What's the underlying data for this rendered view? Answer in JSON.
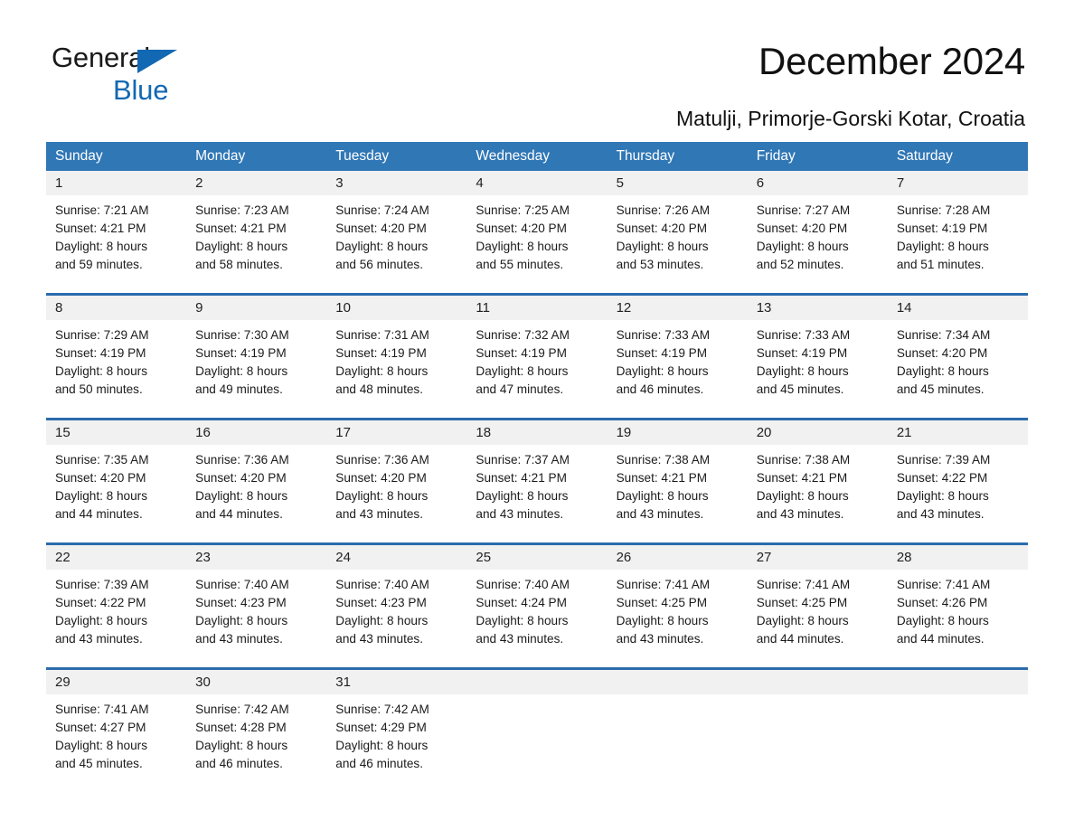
{
  "brand": {
    "name_part1": "General",
    "name_part2": "Blue",
    "triangle_color": "#1268b3",
    "text_color": "#1a1a1a"
  },
  "header": {
    "title": "December 2024",
    "subtitle": "Matulji, Primorje-Gorski Kotar, Croatia"
  },
  "theme": {
    "header_blue": "#3077b6",
    "separator_blue": "#2b6cad",
    "date_row_gray": "#f1f1f1",
    "body_white": "#ffffff",
    "text_dark": "#1b1b1b"
  },
  "weekdays": [
    "Sunday",
    "Monday",
    "Tuesday",
    "Wednesday",
    "Thursday",
    "Friday",
    "Saturday"
  ],
  "weeks": [
    {
      "dates": [
        "1",
        "2",
        "3",
        "4",
        "5",
        "6",
        "7"
      ],
      "cells": [
        {
          "sunrise": "Sunrise: 7:21 AM",
          "sunset": "Sunset: 4:21 PM",
          "daylight1": "Daylight: 8 hours",
          "daylight2": "and 59 minutes."
        },
        {
          "sunrise": "Sunrise: 7:23 AM",
          "sunset": "Sunset: 4:21 PM",
          "daylight1": "Daylight: 8 hours",
          "daylight2": "and 58 minutes."
        },
        {
          "sunrise": "Sunrise: 7:24 AM",
          "sunset": "Sunset: 4:20 PM",
          "daylight1": "Daylight: 8 hours",
          "daylight2": "and 56 minutes."
        },
        {
          "sunrise": "Sunrise: 7:25 AM",
          "sunset": "Sunset: 4:20 PM",
          "daylight1": "Daylight: 8 hours",
          "daylight2": "and 55 minutes."
        },
        {
          "sunrise": "Sunrise: 7:26 AM",
          "sunset": "Sunset: 4:20 PM",
          "daylight1": "Daylight: 8 hours",
          "daylight2": "and 53 minutes."
        },
        {
          "sunrise": "Sunrise: 7:27 AM",
          "sunset": "Sunset: 4:20 PM",
          "daylight1": "Daylight: 8 hours",
          "daylight2": "and 52 minutes."
        },
        {
          "sunrise": "Sunrise: 7:28 AM",
          "sunset": "Sunset: 4:19 PM",
          "daylight1": "Daylight: 8 hours",
          "daylight2": "and 51 minutes."
        }
      ]
    },
    {
      "dates": [
        "8",
        "9",
        "10",
        "11",
        "12",
        "13",
        "14"
      ],
      "cells": [
        {
          "sunrise": "Sunrise: 7:29 AM",
          "sunset": "Sunset: 4:19 PM",
          "daylight1": "Daylight: 8 hours",
          "daylight2": "and 50 minutes."
        },
        {
          "sunrise": "Sunrise: 7:30 AM",
          "sunset": "Sunset: 4:19 PM",
          "daylight1": "Daylight: 8 hours",
          "daylight2": "and 49 minutes."
        },
        {
          "sunrise": "Sunrise: 7:31 AM",
          "sunset": "Sunset: 4:19 PM",
          "daylight1": "Daylight: 8 hours",
          "daylight2": "and 48 minutes."
        },
        {
          "sunrise": "Sunrise: 7:32 AM",
          "sunset": "Sunset: 4:19 PM",
          "daylight1": "Daylight: 8 hours",
          "daylight2": "and 47 minutes."
        },
        {
          "sunrise": "Sunrise: 7:33 AM",
          "sunset": "Sunset: 4:19 PM",
          "daylight1": "Daylight: 8 hours",
          "daylight2": "and 46 minutes."
        },
        {
          "sunrise": "Sunrise: 7:33 AM",
          "sunset": "Sunset: 4:19 PM",
          "daylight1": "Daylight: 8 hours",
          "daylight2": "and 45 minutes."
        },
        {
          "sunrise": "Sunrise: 7:34 AM",
          "sunset": "Sunset: 4:20 PM",
          "daylight1": "Daylight: 8 hours",
          "daylight2": "and 45 minutes."
        }
      ]
    },
    {
      "dates": [
        "15",
        "16",
        "17",
        "18",
        "19",
        "20",
        "21"
      ],
      "cells": [
        {
          "sunrise": "Sunrise: 7:35 AM",
          "sunset": "Sunset: 4:20 PM",
          "daylight1": "Daylight: 8 hours",
          "daylight2": "and 44 minutes."
        },
        {
          "sunrise": "Sunrise: 7:36 AM",
          "sunset": "Sunset: 4:20 PM",
          "daylight1": "Daylight: 8 hours",
          "daylight2": "and 44 minutes."
        },
        {
          "sunrise": "Sunrise: 7:36 AM",
          "sunset": "Sunset: 4:20 PM",
          "daylight1": "Daylight: 8 hours",
          "daylight2": "and 43 minutes."
        },
        {
          "sunrise": "Sunrise: 7:37 AM",
          "sunset": "Sunset: 4:21 PM",
          "daylight1": "Daylight: 8 hours",
          "daylight2": "and 43 minutes."
        },
        {
          "sunrise": "Sunrise: 7:38 AM",
          "sunset": "Sunset: 4:21 PM",
          "daylight1": "Daylight: 8 hours",
          "daylight2": "and 43 minutes."
        },
        {
          "sunrise": "Sunrise: 7:38 AM",
          "sunset": "Sunset: 4:21 PM",
          "daylight1": "Daylight: 8 hours",
          "daylight2": "and 43 minutes."
        },
        {
          "sunrise": "Sunrise: 7:39 AM",
          "sunset": "Sunset: 4:22 PM",
          "daylight1": "Daylight: 8 hours",
          "daylight2": "and 43 minutes."
        }
      ]
    },
    {
      "dates": [
        "22",
        "23",
        "24",
        "25",
        "26",
        "27",
        "28"
      ],
      "cells": [
        {
          "sunrise": "Sunrise: 7:39 AM",
          "sunset": "Sunset: 4:22 PM",
          "daylight1": "Daylight: 8 hours",
          "daylight2": "and 43 minutes."
        },
        {
          "sunrise": "Sunrise: 7:40 AM",
          "sunset": "Sunset: 4:23 PM",
          "daylight1": "Daylight: 8 hours",
          "daylight2": "and 43 minutes."
        },
        {
          "sunrise": "Sunrise: 7:40 AM",
          "sunset": "Sunset: 4:23 PM",
          "daylight1": "Daylight: 8 hours",
          "daylight2": "and 43 minutes."
        },
        {
          "sunrise": "Sunrise: 7:40 AM",
          "sunset": "Sunset: 4:24 PM",
          "daylight1": "Daylight: 8 hours",
          "daylight2": "and 43 minutes."
        },
        {
          "sunrise": "Sunrise: 7:41 AM",
          "sunset": "Sunset: 4:25 PM",
          "daylight1": "Daylight: 8 hours",
          "daylight2": "and 43 minutes."
        },
        {
          "sunrise": "Sunrise: 7:41 AM",
          "sunset": "Sunset: 4:25 PM",
          "daylight1": "Daylight: 8 hours",
          "daylight2": "and 44 minutes."
        },
        {
          "sunrise": "Sunrise: 7:41 AM",
          "sunset": "Sunset: 4:26 PM",
          "daylight1": "Daylight: 8 hours",
          "daylight2": "and 44 minutes."
        }
      ]
    },
    {
      "dates": [
        "29",
        "30",
        "31",
        "",
        "",
        "",
        ""
      ],
      "cells": [
        {
          "sunrise": "Sunrise: 7:41 AM",
          "sunset": "Sunset: 4:27 PM",
          "daylight1": "Daylight: 8 hours",
          "daylight2": "and 45 minutes."
        },
        {
          "sunrise": "Sunrise: 7:42 AM",
          "sunset": "Sunset: 4:28 PM",
          "daylight1": "Daylight: 8 hours",
          "daylight2": "and 46 minutes."
        },
        {
          "sunrise": "Sunrise: 7:42 AM",
          "sunset": "Sunset: 4:29 PM",
          "daylight1": "Daylight: 8 hours",
          "daylight2": "and 46 minutes."
        },
        {
          "sunrise": "",
          "sunset": "",
          "daylight1": "",
          "daylight2": ""
        },
        {
          "sunrise": "",
          "sunset": "",
          "daylight1": "",
          "daylight2": ""
        },
        {
          "sunrise": "",
          "sunset": "",
          "daylight1": "",
          "daylight2": ""
        },
        {
          "sunrise": "",
          "sunset": "",
          "daylight1": "",
          "daylight2": ""
        }
      ]
    }
  ]
}
